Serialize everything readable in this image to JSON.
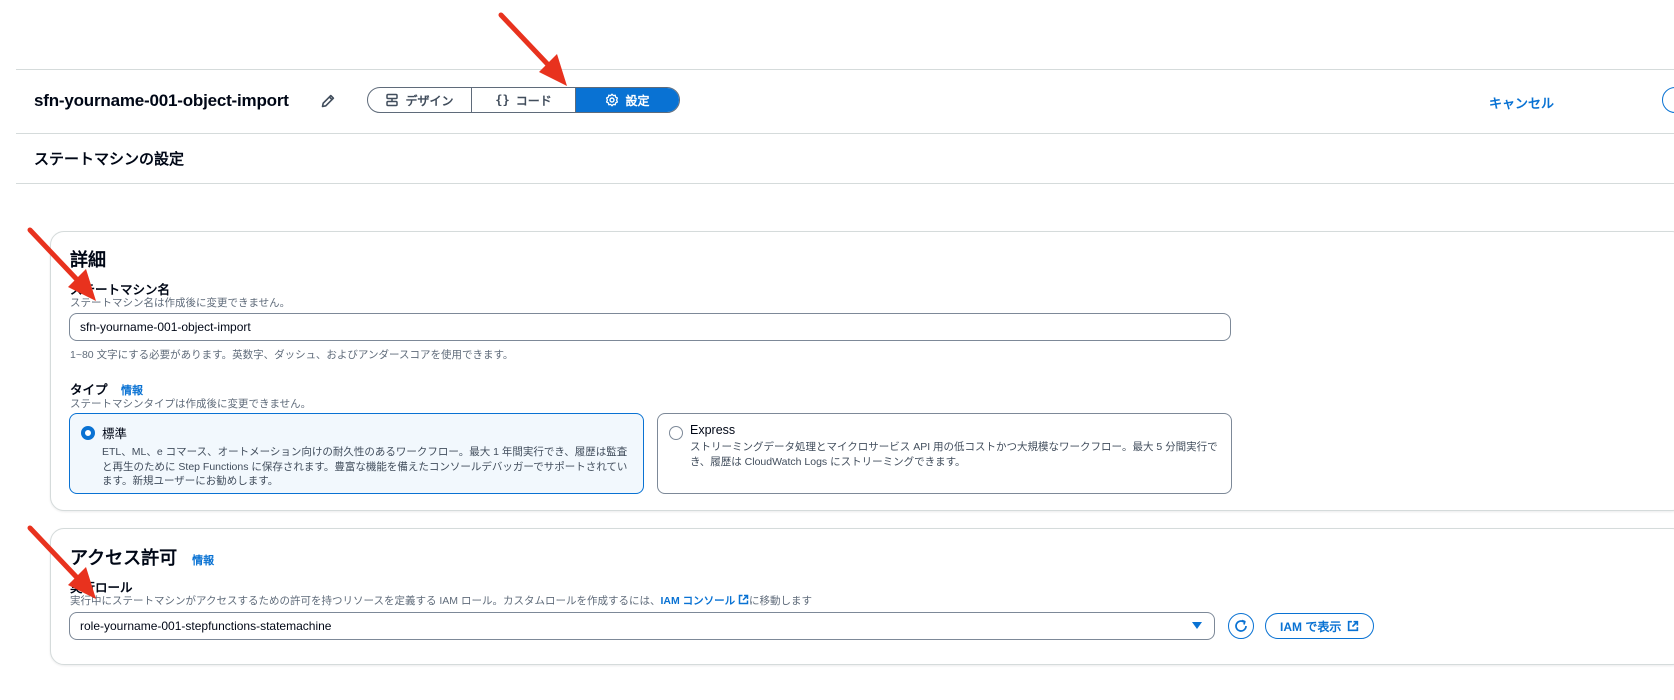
{
  "header": {
    "state_machine_title": "sfn-yourname-001-object-import",
    "tabs": [
      {
        "label": "デザイン",
        "icon": "design-icon"
      },
      {
        "label": "コード",
        "icon": "code-braces-icon"
      },
      {
        "label": "設定",
        "icon": "gear-icon"
      }
    ],
    "active_tab": "設定",
    "cancel_label": "キャンセル"
  },
  "page": {
    "subtitle": "ステートマシンの設定"
  },
  "details": {
    "heading": "詳細",
    "name_label": "ステートマシン名",
    "name_description": "ステートマシン名は作成後に変更できません。",
    "name_value": "sfn-yourname-001-object-import",
    "name_constraint": "1~80 文字にする必要があります。英数字、ダッシュ、およびアンダースコアを使用できます。",
    "type_label": "タイプ",
    "type_info": "情報",
    "type_description": "ステートマシンタイプは作成後に変更できません。",
    "type_options": [
      {
        "title": "標準",
        "description": "ETL、ML、e コマース、オートメーション向けの耐久性のあるワークフロー。最大 1 年間実行でき、履歴は監査と再生のために Step Functions に保存されます。豊富な機能を備えたコンソールデバッガーでサポートされています。新規ユーザーにお勧めします。",
        "selected": true
      },
      {
        "title": "Express",
        "description": "ストリーミングデータ処理とマイクロサービス API 用の低コストかつ大規模なワークフロー。最大 5 分間実行でき、履歴は CloudWatch Logs にストリーミングできます。",
        "selected": false
      }
    ]
  },
  "access": {
    "heading": "アクセス許可",
    "info": "情報",
    "role_label": "実行ロール",
    "role_description_prefix": "実行中にステートマシンがアクセスするための許可を持つリソースを定義する IAM ロール。カスタムロールを作成するには、",
    "role_description_link": "IAM コンソール",
    "role_description_suffix": "に移動します",
    "role_value": "role-yourname-001-stepfunctions-statemachine",
    "view_in_iam_label": "IAM で表示"
  },
  "colors": {
    "accent": "#0972d3",
    "annotation_arrow": "#e8321e"
  }
}
